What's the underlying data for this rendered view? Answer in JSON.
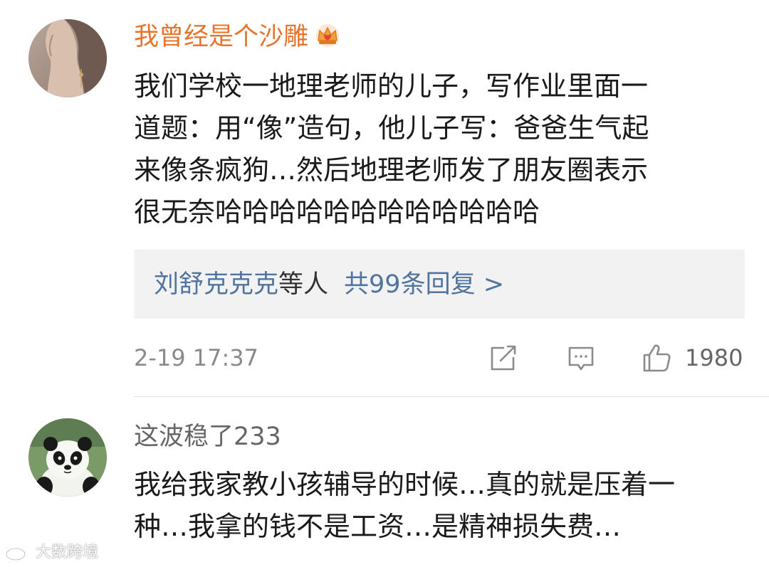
{
  "comments": [
    {
      "username": "我曾经是个沙雕",
      "avatar_icon": "woman-profile-avatar",
      "badge_icon": "crown-icon",
      "text": "我们学校一地理老师的儿子，写作业里面一\n道题：用“像”造句，他儿子写：爸爸生气起\n来像条疯狗…然后地理老师发了朋友圈表示\n很无奈哈哈哈哈哈哈哈哈哈哈哈哈",
      "replies": {
        "names": "刘舒克克克",
        "suffix": "等人",
        "count_text": "共99条回复 >"
      },
      "timestamp": "2-19 17:37",
      "like_count": "1980"
    },
    {
      "username": "这波稳了233",
      "avatar_icon": "panda-avatar",
      "text": "我给我家教小孩辅导的时候…真的就是压着一\n种…我拿的钱不是工资…是精神损失费…"
    }
  ],
  "watermark": {
    "text": "大数跨境"
  },
  "colors": {
    "vip_username": "#e8742b",
    "username": "#666666",
    "link_blue": "#51749e",
    "meta_gray": "#8a8a8a",
    "reply_bg": "#f2f2f2"
  }
}
